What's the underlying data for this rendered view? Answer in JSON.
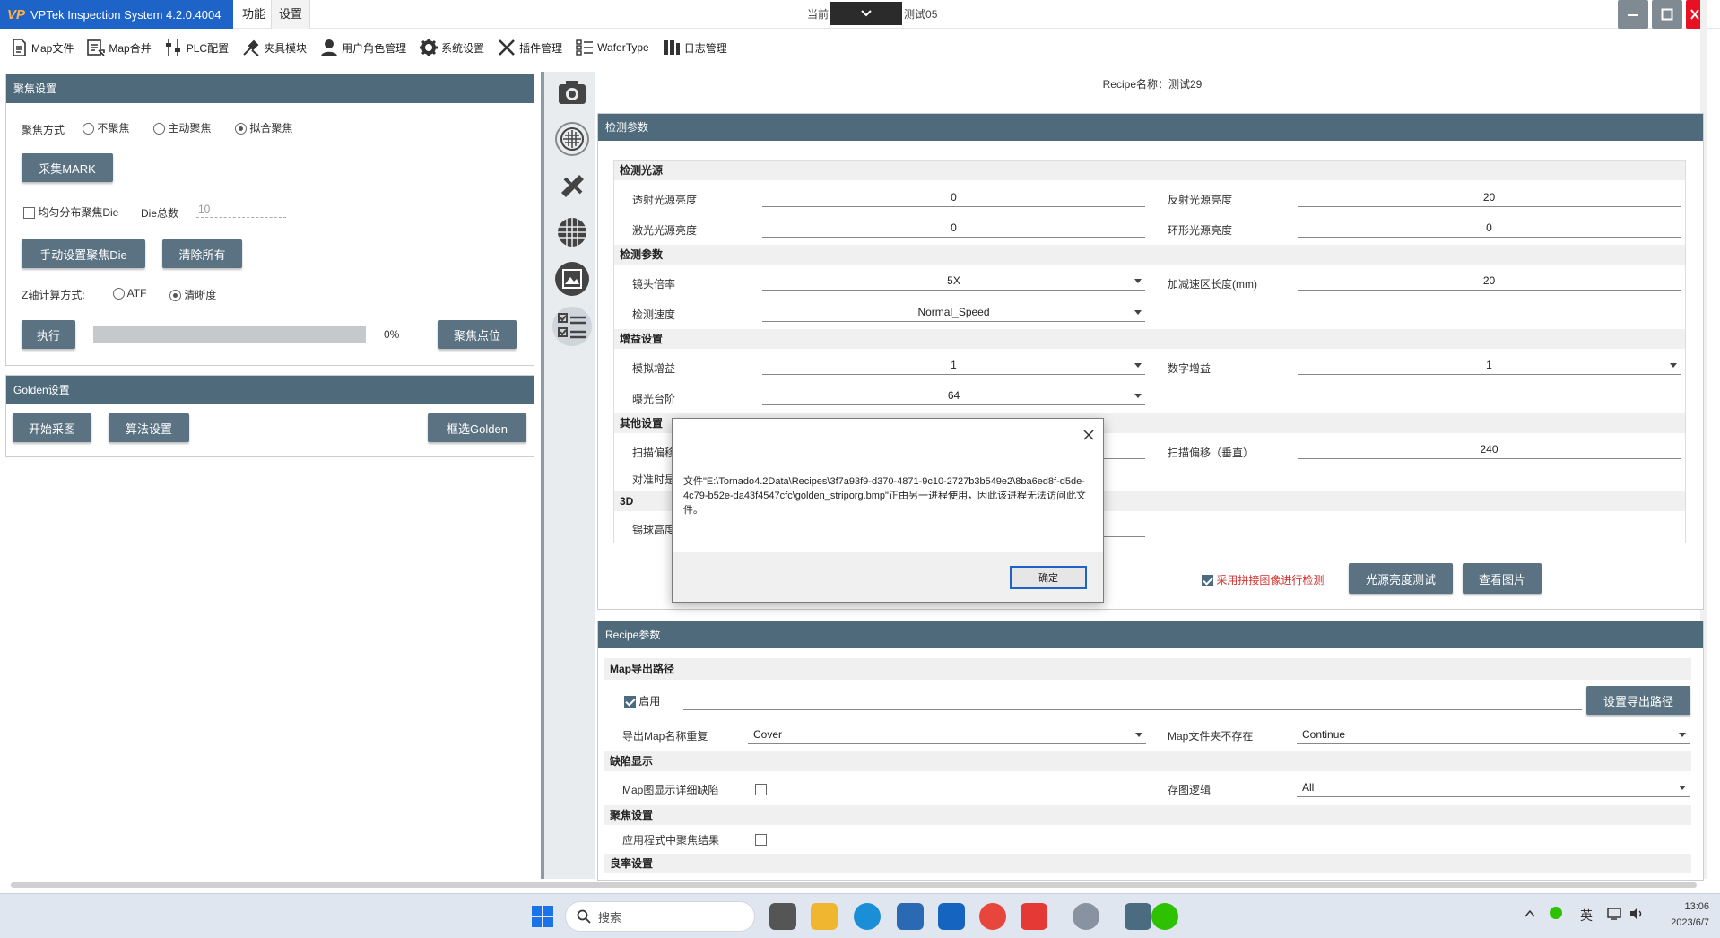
{
  "app": {
    "logo": "VP",
    "title": "VPTek Inspection System 4.2.0.4004"
  },
  "menu": {
    "func": "功能",
    "settings": "设置"
  },
  "recipe_combo": {
    "prefix": "当前",
    "suffix": "测试05"
  },
  "toolbar": [
    {
      "label": "Map文件",
      "icon": "map-file-icon"
    },
    {
      "label": "Map合并",
      "icon": "map-merge-icon"
    },
    {
      "label": "PLC配置",
      "icon": "plc-icon"
    },
    {
      "label": "夹具模块",
      "icon": "tools-icon"
    },
    {
      "label": "用户角色管理",
      "icon": "user-icon"
    },
    {
      "label": "系统设置",
      "icon": "gear-icon"
    },
    {
      "label": "插件管理",
      "icon": "plugin-icon"
    },
    {
      "label": "WaferType",
      "icon": "wafer-type-icon"
    },
    {
      "label": "日志管理",
      "icon": "log-icon"
    }
  ],
  "focus_panel": {
    "title": "聚焦设置",
    "mode_label": "聚焦方式",
    "modes": [
      "不聚焦",
      "主动聚焦",
      "拟合聚焦"
    ],
    "selected_mode": 2,
    "collect_mark": "采集MARK",
    "uniform_label": "均匀分布聚焦Die",
    "die_total_label": "Die总数",
    "die_total_value": "10",
    "manual_btn": "手动设置聚焦Die",
    "clear_btn": "清除所有",
    "z_label": "Z轴计算方式:",
    "z_modes": [
      "ATF",
      "清晰度"
    ],
    "execute_btn": "执行",
    "progress": "0%",
    "progress_value": 0,
    "focus_point_btn": "聚焦点位"
  },
  "golden_panel": {
    "title": "Golden设置",
    "start_btn": "开始采图",
    "algo_btn": "算法设置",
    "select_btn": "框选Golden"
  },
  "recipe_name": "Recipe名称：测试29",
  "detect_panel": {
    "title": "检测参数",
    "light_section": "检测光源",
    "trans_label": "透射光源亮度",
    "trans_value": "0",
    "reflect_label": "反射光源亮度",
    "reflect_value": "20",
    "laser_label": "激光光源亮度",
    "laser_value": "0",
    "ring_label": "环形光源亮度",
    "ring_value": "0",
    "param_section": "检测参数",
    "lens_label": "镜头倍率",
    "lens_value": "5X",
    "accel_label": "加减速区长度(mm)",
    "accel_value": "20",
    "speed_label": "检测速度",
    "speed_value": "Normal_Speed",
    "gain_section": "增益设置",
    "analog_label": "模拟增益",
    "analog_value": "1",
    "digital_label": "数字增益",
    "digital_value": "1",
    "exposure_label": "曝光台阶",
    "exposure_value": "64",
    "other_section": "其他设置",
    "scan_h_label": "扫描偏移",
    "scan_v_label": "扫描偏移（垂直）",
    "scan_v_value": "240",
    "align_label": "对准时是",
    "section_3d": "3D",
    "ball_label": "锡球高度",
    "stitch_label": "采用拼接图像进行检测",
    "light_test_btn": "光源亮度测试",
    "view_img_btn": "查看图片"
  },
  "recipe_panel": {
    "title": "Recipe参数",
    "map_export_section": "Map导出路径",
    "enable_label": "启用",
    "set_path_btn": "设置导出路径",
    "dup_label": "导出Map名称重复",
    "dup_value": "Cover",
    "not_exist_label": "Map文件夹不存在",
    "not_exist_value": "Continue",
    "defect_section": "缺陷显示",
    "detail_label": "Map图显示详细缺陷",
    "save_logic_label": "存图逻辑",
    "save_logic_value": "All",
    "focus_section": "聚焦设置",
    "apply_focus_label": "应用程式中聚焦结果",
    "yield_section": "良率设置"
  },
  "dialog": {
    "message": "文件\"E:\\Tornado4.2Data\\Recipes\\3f7a93f9-d370-4871-9c10-2727b3b549e2\\8ba6ed8f-d5de-4c79-b52e-da43f4547cfc\\golden_striporg.bmp\"正由另一进程使用，因此该进程无法访问此文件。",
    "ok": "确定"
  },
  "taskbar": {
    "search": "搜索",
    "ime": "英",
    "time": "13:06",
    "date": "2023/6/7"
  },
  "colors": {
    "panel_header": "#4f6a7b",
    "button": "#5a7282",
    "accent_blue": "#1e64c8",
    "stitch_red": "#d0312d"
  }
}
